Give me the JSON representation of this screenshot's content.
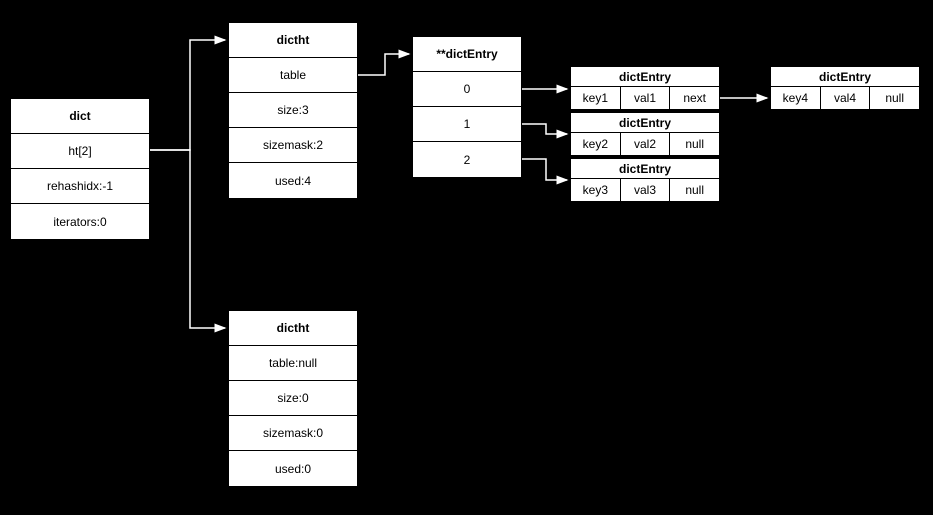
{
  "dict": {
    "title": "dict",
    "rows": [
      "ht[2]",
      "rehashidx:-1",
      "iterators:0"
    ]
  },
  "dictht0": {
    "title": "dictht",
    "rows": [
      "table",
      "size:3",
      "sizemask:2",
      "used:4"
    ]
  },
  "dictht1": {
    "title": "dictht",
    "rows": [
      "table:null",
      "size:0",
      "sizemask:0",
      "used:0"
    ]
  },
  "dictEntryPtr": {
    "title": "**dictEntry",
    "rows": [
      "0",
      "1",
      "2"
    ]
  },
  "entries": [
    {
      "title": "dictEntry",
      "cells": [
        "key1",
        "val1",
        "next"
      ]
    },
    {
      "title": "dictEntry",
      "cells": [
        "key2",
        "val2",
        "null"
      ]
    },
    {
      "title": "dictEntry",
      "cells": [
        "key3",
        "val3",
        "null"
      ]
    },
    {
      "title": "dictEntry",
      "cells": [
        "key4",
        "val4",
        "null"
      ]
    }
  ]
}
